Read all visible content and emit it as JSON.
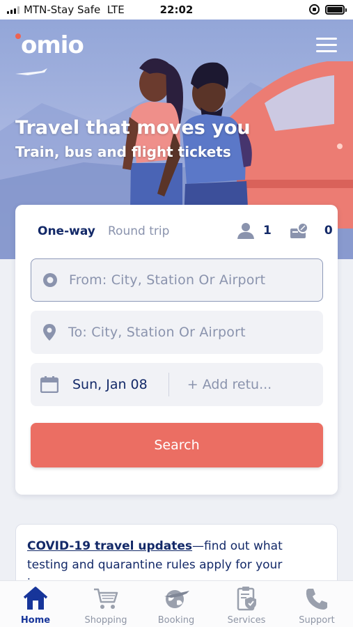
{
  "status_bar": {
    "carrier": "MTN-Stay Safe",
    "network": "LTE",
    "time": "22:02"
  },
  "header": {
    "logo": "omio",
    "menu_icon": "hamburger-menu-icon"
  },
  "hero": {
    "title": "Travel that moves you",
    "subtitle": "Train, bus and flight tickets"
  },
  "search": {
    "trip_types": [
      "One-way",
      "Round trip"
    ],
    "selected_trip_type": "One-way",
    "passengers": "1",
    "discount_cards": "0",
    "from_placeholder": "From: City, Station Or Airport",
    "to_placeholder": "To: City, Station Or Airport",
    "departure_date": "Sun, Jan 08",
    "return_placeholder": "+ Add retu...",
    "search_label": "Search"
  },
  "covid": {
    "link_text": "COVID-19 travel updates",
    "body": "—find out what testing and quarantine rules apply for your journey."
  },
  "tabbar": {
    "items": [
      {
        "label": "Home",
        "icon": "home-icon",
        "active": true
      },
      {
        "label": "Shopping",
        "icon": "shopping-cart-icon",
        "active": false
      },
      {
        "label": "Booking",
        "icon": "globe-plane-icon",
        "active": false
      },
      {
        "label": "Services",
        "icon": "clipboard-shield-icon",
        "active": false
      },
      {
        "label": "Support",
        "icon": "phone-icon",
        "active": false
      }
    ]
  },
  "colors": {
    "brand_red": "#eb6e63",
    "navy": "#132968",
    "active_tab": "#17359a",
    "placeholder": "#8a93ad"
  }
}
